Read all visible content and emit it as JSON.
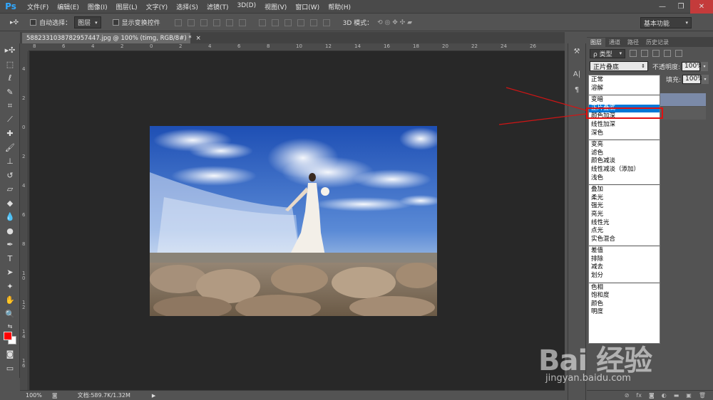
{
  "app": {
    "logo": "Ps"
  },
  "menu": [
    "文件(F)",
    "编辑(E)",
    "图像(I)",
    "图层(L)",
    "文字(Y)",
    "选择(S)",
    "滤镜(T)",
    "3D(D)",
    "视图(V)",
    "窗口(W)",
    "帮助(H)"
  ],
  "options": {
    "auto_select_label": "自动选择：",
    "auto_select_value": "图层",
    "show_transform_label": "显示变换控件",
    "mode_3d_label": "3D 模式：",
    "workspace": "基本功能"
  },
  "document": {
    "tab_title": "5882331038782957447.jpg @ 100% (timg, RGB/8#) *",
    "zoom": "100%",
    "doc_info": "文档:589.7K/1.32M"
  },
  "rulers": {
    "h_ticks": [
      "8",
      "6",
      "4",
      "2",
      "0",
      "2",
      "4",
      "6",
      "8",
      "10",
      "12",
      "14",
      "16",
      "18",
      "20",
      "22",
      "24",
      "26"
    ],
    "v_ticks": [
      "4",
      "2",
      "0",
      "2",
      "4",
      "6",
      "8",
      "1\n0",
      "1\n2",
      "1\n4",
      "1\n6"
    ]
  },
  "panel": {
    "tabs": [
      "图层",
      "通道",
      "路径",
      "历史记录"
    ],
    "filter_label": "ρ 类型",
    "blend_mode": "正片叠底",
    "opacity_label": "不透明度:",
    "opacity_value": "100%",
    "fill_label": "填充:",
    "fill_value": "100%"
  },
  "blend_modes": [
    [
      "正常",
      "溶解"
    ],
    [
      "变暗",
      "正片叠底",
      "颜色加深",
      "线性加深",
      "深色"
    ],
    [
      "变亮",
      "滤色",
      "颜色减淡",
      "线性减淡（添加）",
      "浅色"
    ],
    [
      "叠加",
      "柔光",
      "强光",
      "亮光",
      "线性光",
      "点光",
      "实色混合"
    ],
    [
      "差值",
      "排除",
      "减去",
      "划分"
    ],
    [
      "色相",
      "饱和度",
      "颜色",
      "明度"
    ]
  ],
  "selected_blend_mode": "正片叠底",
  "watermark": {
    "text": "Bai 经验",
    "sub": "jingyan.baidu.com"
  },
  "colors": {
    "foreground": "#ff0000",
    "background": "#ffffff",
    "highlight": "#e01010",
    "selection": "#0078d7"
  }
}
